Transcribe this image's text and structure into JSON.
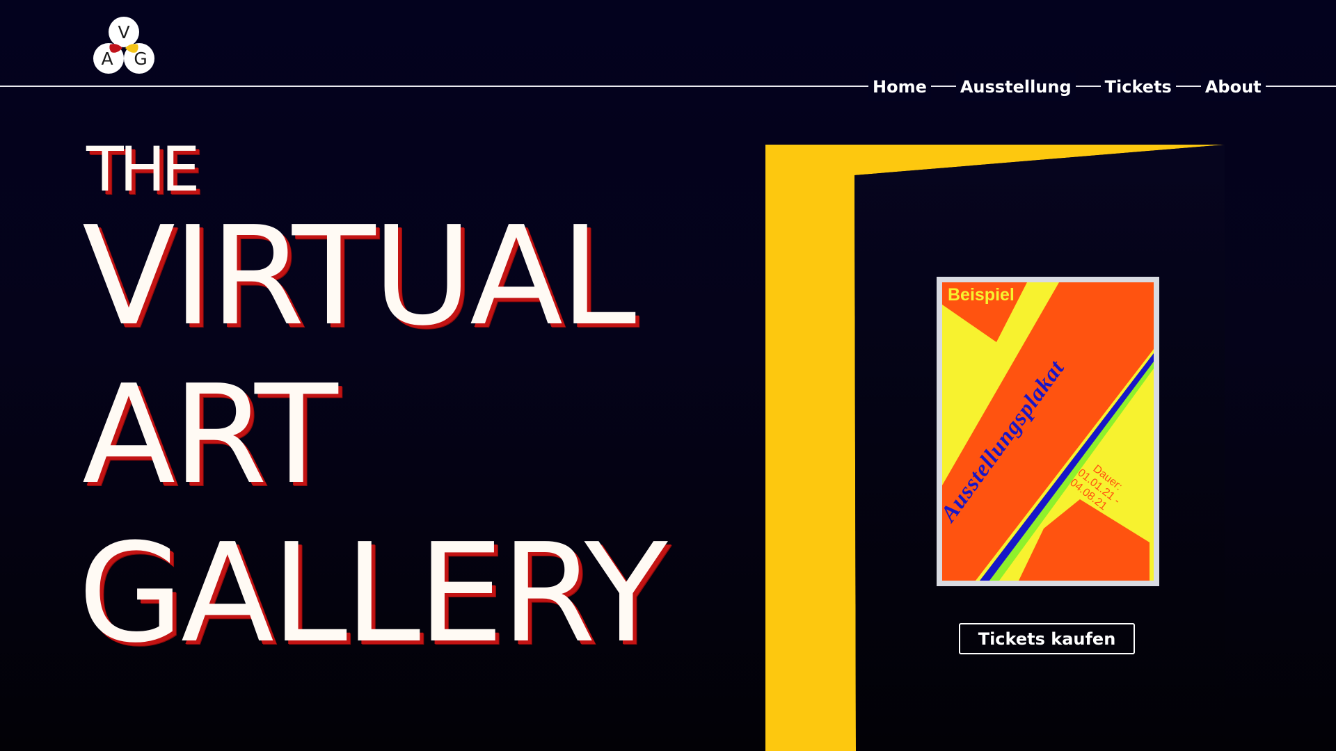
{
  "brand": {
    "logo_letters": [
      "V",
      "A",
      "G"
    ],
    "logo_colors": {
      "red": "#c0121b",
      "yellow": "#f5c518",
      "circle": "#ffffff"
    }
  },
  "nav": {
    "items": [
      {
        "label": "Home"
      },
      {
        "label": "Ausstellung"
      },
      {
        "label": "Tickets"
      },
      {
        "label": "About"
      }
    ]
  },
  "hero": {
    "lines": [
      "THE",
      "VIRTUAL",
      "ART",
      "GALLERY"
    ]
  },
  "poster": {
    "label": "Beispiel",
    "title": "Ausstellungsplakat",
    "duration_label": "Dauer:",
    "date_start": "01.01.21 -",
    "date_end": "04.08.21"
  },
  "cta": {
    "label": "Tickets kaufen"
  },
  "colors": {
    "background": "#03021e",
    "hero_text": "#fffaf4",
    "hero_shadow": "#c31313",
    "door_frame": "#fdc80f",
    "poster_yellow": "#f7f22f",
    "poster_orange": "#ff5310",
    "poster_blue": "#1716c8",
    "poster_green": "#8ef12c"
  }
}
